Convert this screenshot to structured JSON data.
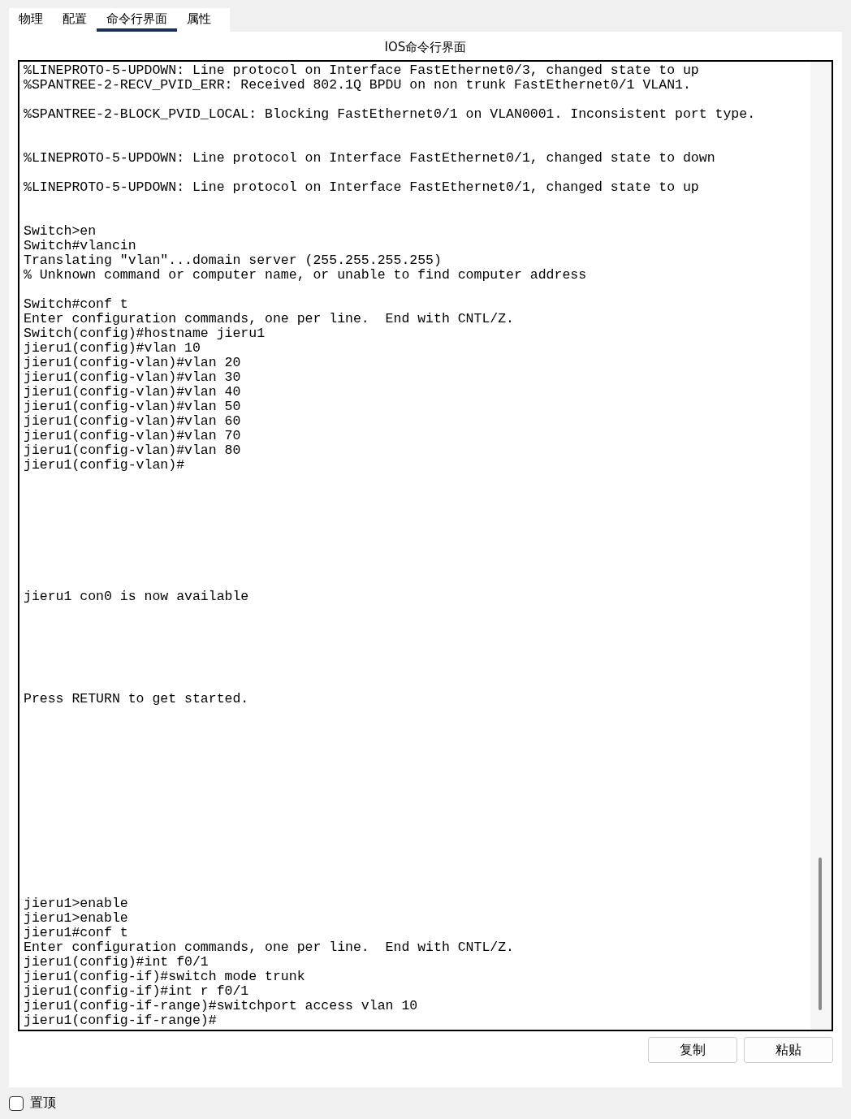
{
  "tabs": [
    {
      "label": "物理",
      "selected": false
    },
    {
      "label": "配置",
      "selected": false
    },
    {
      "label": "命令行界面",
      "selected": true
    },
    {
      "label": "属性",
      "selected": false
    }
  ],
  "panel_title": "IOS命令行界面",
  "terminal": {
    "output": "%LINEPROTO-5-UPDOWN: Line protocol on Interface FastEthernet0/3, changed state to up\n%SPANTREE-2-RECV_PVID_ERR: Received 802.1Q BPDU on non trunk FastEthernet0/1 VLAN1.\n\n%SPANTREE-2-BLOCK_PVID_LOCAL: Blocking FastEthernet0/1 on VLAN0001. Inconsistent port type.\n\n\n%LINEPROTO-5-UPDOWN: Line protocol on Interface FastEthernet0/1, changed state to down\n\n%LINEPROTO-5-UPDOWN: Line protocol on Interface FastEthernet0/1, changed state to up\n\n\nSwitch>en\nSwitch#vlancin\nTranslating \"vlan\"...domain server (255.255.255.255)\n% Unknown command or computer name, or unable to find computer address\n\nSwitch#conf t\nEnter configuration commands, one per line.  End with CNTL/Z.\nSwitch(config)#hostname jieru1\njieru1(config)#vlan 10\njieru1(config-vlan)#vlan 20\njieru1(config-vlan)#vlan 30\njieru1(config-vlan)#vlan 40\njieru1(config-vlan)#vlan 50\njieru1(config-vlan)#vlan 60\njieru1(config-vlan)#vlan 70\njieru1(config-vlan)#vlan 80\njieru1(config-vlan)#\n\n\n\n\n\n\n\n\njieru1 con0 is now available\n\n\n\n\n\n\nPress RETURN to get started.\n\n\n\n\n\n\n\n\n\n\n\n\n\njieru1>enable\njieru1>enable\njieru1#conf t\nEnter configuration commands, one per line.  End with CNTL/Z.\njieru1(config)#int f0/1\njieru1(config-if)#switch mode trunk\njieru1(config-if)#int r f0/1\njieru1(config-if-range)#switchport access vlan 10\njieru1(config-if-range)#"
  },
  "buttons": [
    {
      "label": "复制"
    },
    {
      "label": "粘贴"
    }
  ],
  "always_on_top": {
    "label": "置顶",
    "checked": false
  }
}
